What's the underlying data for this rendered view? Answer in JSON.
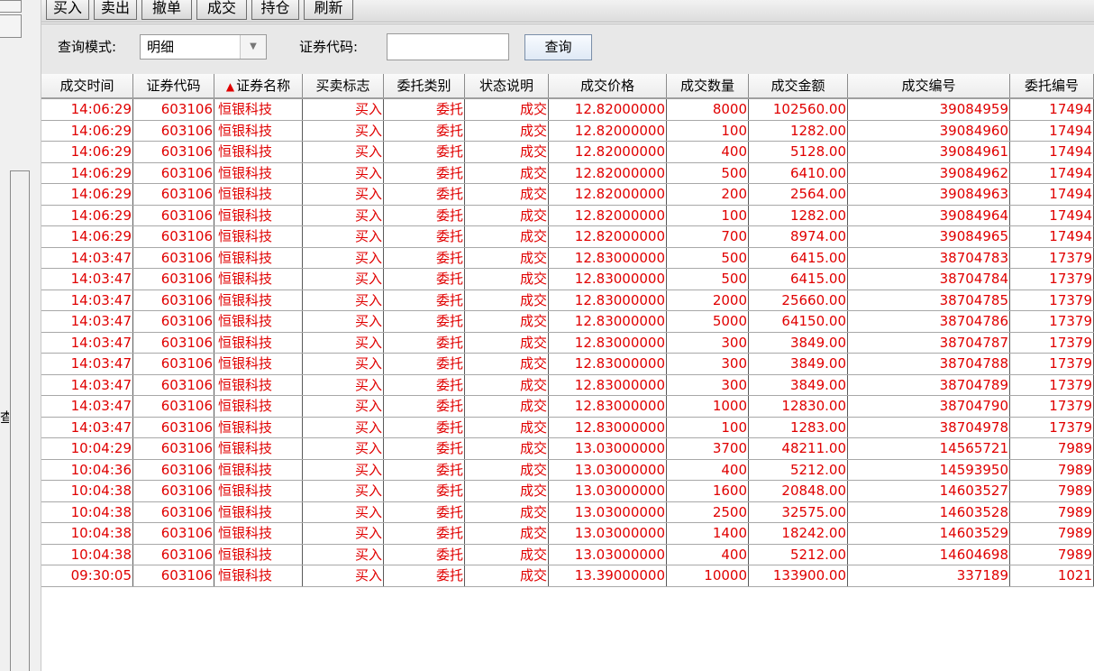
{
  "toolbar": {
    "buttons": [
      "买入",
      "卖出",
      "撤单",
      "成交",
      "持仓",
      "刷新"
    ]
  },
  "left_panel": {
    "partial_char": "查"
  },
  "query": {
    "mode_label": "查询模式:",
    "mode_value": "明细",
    "code_label": "证券代码:",
    "code_value": "",
    "search_button": "查询"
  },
  "table": {
    "sort_indicator": "▲",
    "columns": [
      "成交时间",
      "证券代码",
      "证券名称",
      "买卖标志",
      "委托类别",
      "状态说明",
      "成交价格",
      "成交数量",
      "成交金额",
      "成交编号",
      "委托编号"
    ],
    "rows": [
      [
        "14:06:29",
        "603106",
        "恒银科技",
        "买入",
        "委托",
        "成交",
        "12.82000000",
        "8000",
        "102560.00",
        "39084959",
        "17494"
      ],
      [
        "14:06:29",
        "603106",
        "恒银科技",
        "买入",
        "委托",
        "成交",
        "12.82000000",
        "100",
        "1282.00",
        "39084960",
        "17494"
      ],
      [
        "14:06:29",
        "603106",
        "恒银科技",
        "买入",
        "委托",
        "成交",
        "12.82000000",
        "400",
        "5128.00",
        "39084961",
        "17494"
      ],
      [
        "14:06:29",
        "603106",
        "恒银科技",
        "买入",
        "委托",
        "成交",
        "12.82000000",
        "500",
        "6410.00",
        "39084962",
        "17494"
      ],
      [
        "14:06:29",
        "603106",
        "恒银科技",
        "买入",
        "委托",
        "成交",
        "12.82000000",
        "200",
        "2564.00",
        "39084963",
        "17494"
      ],
      [
        "14:06:29",
        "603106",
        "恒银科技",
        "买入",
        "委托",
        "成交",
        "12.82000000",
        "100",
        "1282.00",
        "39084964",
        "17494"
      ],
      [
        "14:06:29",
        "603106",
        "恒银科技",
        "买入",
        "委托",
        "成交",
        "12.82000000",
        "700",
        "8974.00",
        "39084965",
        "17494"
      ],
      [
        "14:03:47",
        "603106",
        "恒银科技",
        "买入",
        "委托",
        "成交",
        "12.83000000",
        "500",
        "6415.00",
        "38704783",
        "17379"
      ],
      [
        "14:03:47",
        "603106",
        "恒银科技",
        "买入",
        "委托",
        "成交",
        "12.83000000",
        "500",
        "6415.00",
        "38704784",
        "17379"
      ],
      [
        "14:03:47",
        "603106",
        "恒银科技",
        "买入",
        "委托",
        "成交",
        "12.83000000",
        "2000",
        "25660.00",
        "38704785",
        "17379"
      ],
      [
        "14:03:47",
        "603106",
        "恒银科技",
        "买入",
        "委托",
        "成交",
        "12.83000000",
        "5000",
        "64150.00",
        "38704786",
        "17379"
      ],
      [
        "14:03:47",
        "603106",
        "恒银科技",
        "买入",
        "委托",
        "成交",
        "12.83000000",
        "300",
        "3849.00",
        "38704787",
        "17379"
      ],
      [
        "14:03:47",
        "603106",
        "恒银科技",
        "买入",
        "委托",
        "成交",
        "12.83000000",
        "300",
        "3849.00",
        "38704788",
        "17379"
      ],
      [
        "14:03:47",
        "603106",
        "恒银科技",
        "买入",
        "委托",
        "成交",
        "12.83000000",
        "300",
        "3849.00",
        "38704789",
        "17379"
      ],
      [
        "14:03:47",
        "603106",
        "恒银科技",
        "买入",
        "委托",
        "成交",
        "12.83000000",
        "1000",
        "12830.00",
        "38704790",
        "17379"
      ],
      [
        "14:03:47",
        "603106",
        "恒银科技",
        "买入",
        "委托",
        "成交",
        "12.83000000",
        "100",
        "1283.00",
        "38704978",
        "17379"
      ],
      [
        "10:04:29",
        "603106",
        "恒银科技",
        "买入",
        "委托",
        "成交",
        "13.03000000",
        "3700",
        "48211.00",
        "14565721",
        "7989"
      ],
      [
        "10:04:36",
        "603106",
        "恒银科技",
        "买入",
        "委托",
        "成交",
        "13.03000000",
        "400",
        "5212.00",
        "14593950",
        "7989"
      ],
      [
        "10:04:38",
        "603106",
        "恒银科技",
        "买入",
        "委托",
        "成交",
        "13.03000000",
        "1600",
        "20848.00",
        "14603527",
        "7989"
      ],
      [
        "10:04:38",
        "603106",
        "恒银科技",
        "买入",
        "委托",
        "成交",
        "13.03000000",
        "2500",
        "32575.00",
        "14603528",
        "7989"
      ],
      [
        "10:04:38",
        "603106",
        "恒银科技",
        "买入",
        "委托",
        "成交",
        "13.03000000",
        "1400",
        "18242.00",
        "14603529",
        "7989"
      ],
      [
        "10:04:38",
        "603106",
        "恒银科技",
        "买入",
        "委托",
        "成交",
        "13.03000000",
        "400",
        "5212.00",
        "14604698",
        "7989"
      ],
      [
        "09:30:05",
        "603106",
        "恒银科技",
        "买入",
        "委托",
        "成交",
        "13.39000000",
        "10000",
        "133900.00",
        "337189",
        "1021"
      ]
    ]
  },
  "colors": {
    "row_text": "#e00000",
    "grid": "#5a5a5a"
  }
}
